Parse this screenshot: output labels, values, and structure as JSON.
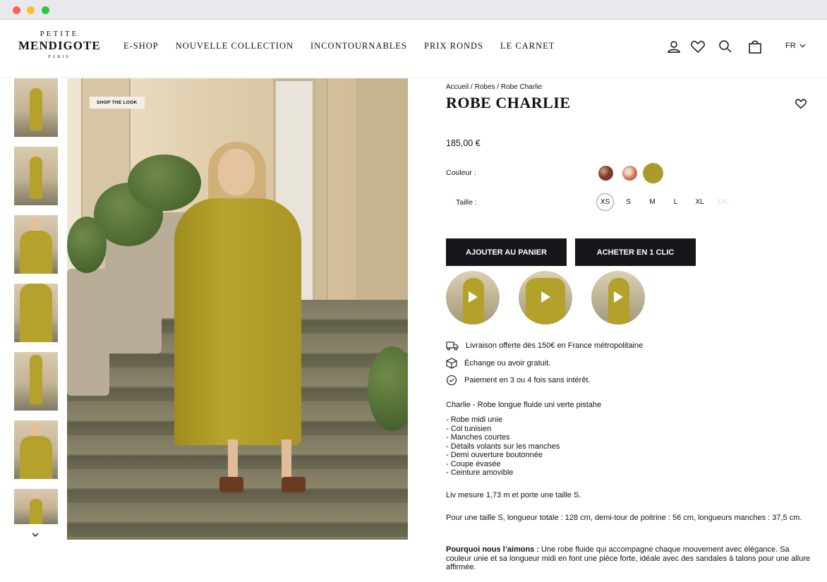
{
  "header": {
    "logo": {
      "line1": "PETITE",
      "line2": "MENDIGOTE",
      "line3": "PARIS"
    },
    "nav": [
      "E-SHOP",
      "NOUVELLE COLLECTION",
      "INCONTOURNABLES",
      "PRIX RONDS",
      "LE CARNET"
    ],
    "icons": [
      "account-icon",
      "heart-icon",
      "search-icon",
      "bag-icon"
    ],
    "lang": "FR"
  },
  "gallery": {
    "badge": "SHOP THE LOOK",
    "thumbnail_count": 7,
    "active_index": 0
  },
  "product": {
    "breadcrumb": [
      "Accueil",
      "Robes",
      "Robe Charlie"
    ],
    "title": "ROBE CHARLIE",
    "price": "185,00 €",
    "color_label": "Couleur :",
    "colors": [
      "#7a3a2e",
      "#e3b49e",
      "#a99a2a"
    ],
    "selected_color_index": 2,
    "size_label": "Taille :",
    "sizes": [
      "XS",
      "S",
      "M",
      "L",
      "XL",
      "XXL"
    ],
    "selected_size": "XS",
    "unavailable_sizes": [
      "XXL"
    ],
    "add_to_cart": "AJOUTER AU PANIER",
    "buy_one_click": "ACHETER EN 1 CLIC",
    "features": [
      "Livraison offerte dès 150€ en France métropolitaine",
      "Échange ou avoir gratuit.",
      "Paiement en 3 ou 4 fois sans intérêt."
    ],
    "description_title": "Charlie - Robe longue fluide uni verte pistahe",
    "bullets": [
      "- Robe midi unie",
      "- Col tunisien",
      "- Manches courtes",
      "- Détails volants sur les manches",
      "- Demi ouverture boutonnée",
      "- Coupe évasée",
      "- Ceinture amovible"
    ],
    "model_info": "Liv mesure 1,73 m et porte une taille S.",
    "measurements": "Pour une taille S, longueur totale : 128 cm, demi-tour de poitrine : 56 cm, longueurs manches : 37,5 cm.",
    "why_title": "Pourquoi nous l’aimons :",
    "why_text": " Une robe fluide qui accompagne chaque mouvement avec élégance. Sa couleur unie et sa longueur midi en font une pièce forte, idéale avec des sandales à talons pour une allure affirmée."
  }
}
